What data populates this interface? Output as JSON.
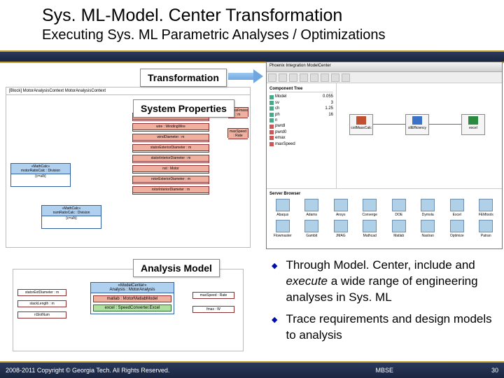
{
  "header": {
    "title": "Sys. ML-Model. Center Transformation",
    "subtitle": "Executing Sys. ML Parametric Analyses / Optimizations"
  },
  "labels": {
    "transformation": "Transformation",
    "system_properties": "System Properties",
    "analysis_model": "Analysis Model"
  },
  "sys_diagram": {
    "title": "[Block] MotorAnalysisContext   MotorAnalysisContext",
    "motor_header": "motor : Motor",
    "blocks": [
      "stackLength : m",
      "wire : WindingWire",
      "windDiameter : m",
      "statorExteriorDiameter : m",
      "statorInteriorDiameter : m",
      "nst : Motor",
      "rotorExteriorDiameter : m",
      "rotorInteriorDiameter : m"
    ],
    "left_blocks": [
      {
        "stereo": "«MathCalc»",
        "name": "motorRatioCalc : Division",
        "expr": "{c=a/b}"
      },
      {
        "stereo": "«MathCalc»",
        "name": "nsmRatioCalc : Division",
        "expr": "{c=a/b}"
      }
    ],
    "mass_block": "massFmass : m",
    "max_speed": "maxSpeed : Rate"
  },
  "analysis_diagram": {
    "stereo": "«ModelCenter»",
    "name": "Analysis : MotorAnalysis",
    "blocks": [
      {
        "name": "matlab : MotorMatlabModel",
        "color": "r"
      },
      {
        "name": "excel : SpeedConverter.Excel",
        "color": "g"
      }
    ],
    "inputs": [
      "statorExtDiameter : m",
      "stackLength : m",
      "nSlotNum"
    ],
    "outputs": [
      "maxSpeed : Rate",
      "fmax : W"
    ]
  },
  "modelcenter": {
    "window_title": "Phoenix Integration ModelCenter",
    "tree_header": "Component Tree",
    "tree": [
      "Model",
      "sv",
      "ch",
      "ph",
      "n",
      "pwrdl",
      "pwrd0",
      "emax",
      "maxSpeed"
    ],
    "tree_vals": [
      "0.055",
      "3",
      "1.25",
      "16",
      ""
    ],
    "workflow": [
      "coilMassCalc",
      "sllEfficiency",
      "excel"
    ],
    "lib_header": "Server Browser",
    "lib": [
      "Abaqus",
      "Adams",
      "Ansys",
      "Converge",
      "DOE",
      "Dymola",
      "Excel",
      "FEMtools",
      "Flowmaster",
      "Gambit",
      "JMAG",
      "Mathcad",
      "Matlab",
      "Nastran",
      "Optimize",
      "Patran"
    ]
  },
  "bullets": [
    {
      "pre": "Through Model. Center, include and ",
      "em": "execute",
      "post": " a wide range of engineering analyses in Sys. ML"
    },
    {
      "pre": "Trace requirements and design models to analysis",
      "em": "",
      "post": ""
    }
  ],
  "footer": {
    "copyright": "2008-2011 Copyright © Georgia Tech. All Rights Reserved.",
    "center": "MBSE",
    "page": "30"
  }
}
